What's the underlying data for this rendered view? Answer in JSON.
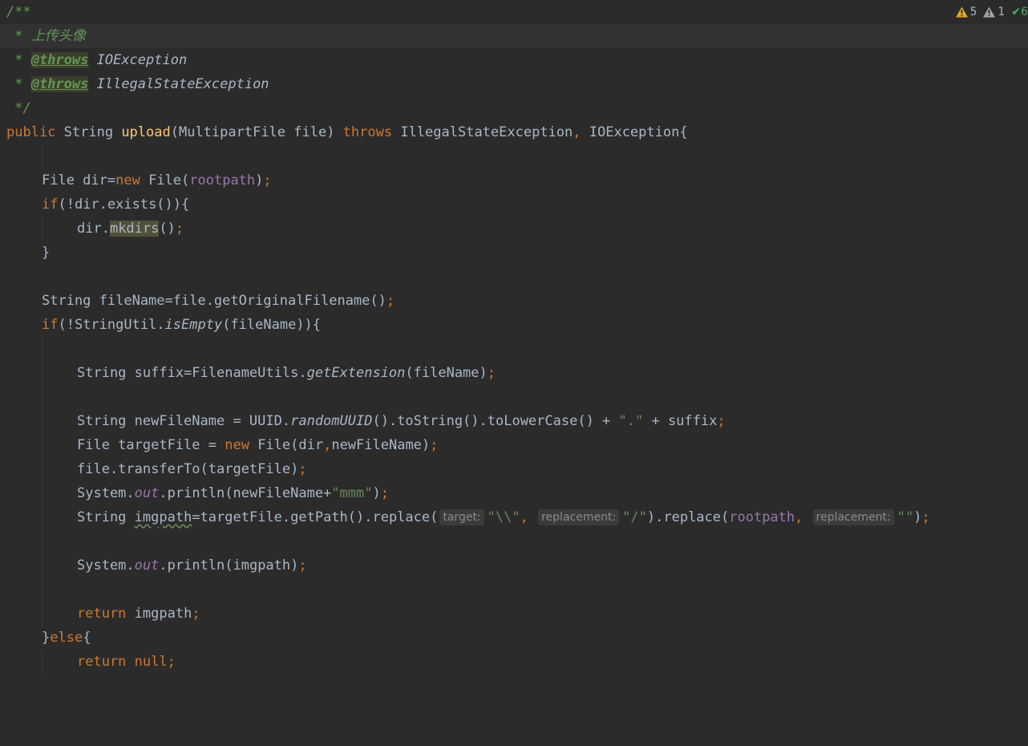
{
  "inspections": {
    "errors_count": "5",
    "warnings_count": "1",
    "check_glyph": "✔",
    "typo_count": "6",
    "colors": {
      "error": "#e2a628",
      "warning": "#a4a4a4",
      "ok": "#4caf6b"
    }
  },
  "code": {
    "l1": "/**",
    "l2": " * 上传头像",
    "l3_star": " * ",
    "l3_tag": "@throws",
    "l3_type": " IOException",
    "l4_star": " * ",
    "l4_tag": "@throws",
    "l4_type": " IllegalStateException",
    "l5": " */",
    "l6": {
      "kw_public": "public",
      "sp1": " String ",
      "name": "upload",
      "params": "(MultipartFile file) ",
      "kw_throws": "throws",
      "ex1": " IllegalStateException",
      "comma": ",",
      "ex2": " IOException{"
    },
    "l8": {
      "a": "File dir=",
      "kw_new": "new",
      "b": " File(",
      "field": "rootpath",
      "c": ")",
      "semi": ";"
    },
    "l9": {
      "kw_if": "if",
      "a": "(!dir.exists()){"
    },
    "l10": {
      "a": "dir.",
      "hl": "mkdirs",
      "b": "()",
      "semi": ";"
    },
    "l11": "}",
    "l13": {
      "a": "String fileName=file.getOriginalFilename()",
      "semi": ";"
    },
    "l14": {
      "kw_if": "if",
      "a": "(!StringUtil.",
      "m": "isEmpty",
      "b": "(fileName)){"
    },
    "l16": {
      "a": "String suffix=FilenameUtils.",
      "m": "getExtension",
      "b": "(fileName)",
      "semi": ";"
    },
    "l18": {
      "a": "String newFileName = UUID.",
      "m": "randomUUID",
      "b": "().toString().toLowerCase() + ",
      "str": "\".\"",
      "c": " + suffix",
      "semi": ";"
    },
    "l19": {
      "a": "File targetFile = ",
      "kw_new": "new",
      "b": " File(dir",
      "comma": ",",
      "c": "newFileName)",
      "semi": ";"
    },
    "l20": {
      "a": "file.transferTo(targetFile)",
      "semi": ";"
    },
    "l21": {
      "a": "System.",
      "sf": "out",
      "b": ".println(newFileName+",
      "str": "\"mmm\"",
      "c": ")",
      "semi": ";"
    },
    "l22": {
      "a": "String ",
      "warn": "imgpath",
      "b": "=targetFile.getPath().replace(",
      "hint1": "target:",
      "str1": "\"\\\\\"",
      "comma1": ",",
      "hint2": "replacement:",
      "str2": "\"/\"",
      "c": ").replace(",
      "field": "rootpath",
      "comma2": ",",
      "hint3": "replacement:",
      "str3": "\"\"",
      "d": ")",
      "semi": ";"
    },
    "l24": {
      "a": "System.",
      "sf": "out",
      "b": ".println(imgpath)",
      "semi": ";"
    },
    "l26": {
      "kw_return": "return",
      "a": " imgpath",
      "semi": ";"
    },
    "l27": {
      "a": "}",
      "kw_else": "else",
      "b": "{"
    },
    "l28": {
      "kw_return": "return",
      "a": " ",
      "kw_null": "null",
      "semi": ";"
    }
  }
}
